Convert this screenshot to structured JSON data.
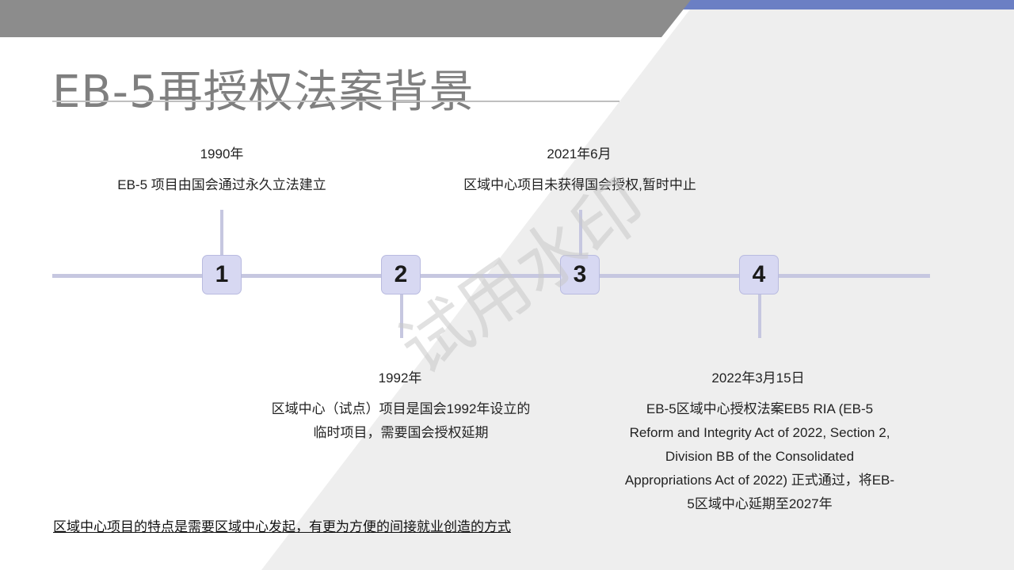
{
  "slide": {
    "title": "EB-5再授权法案背景",
    "colors": {
      "top_band_gray": "#8c8c8c",
      "top_band_blue": "#6b7fc4",
      "diagonal_gray": "#eeeeee",
      "timeline": "#c6c7e0",
      "marker_fill": "#d7d8f2"
    },
    "watermark": "试用水印"
  },
  "timeline": {
    "events": [
      {
        "number": "1",
        "date": "1990年",
        "lines": [
          "EB-5 项目由国会通过永久立法建立"
        ]
      },
      {
        "number": "2",
        "date": "1992年",
        "lines": [
          "区域中心（试点）项目是国会1992年设立的",
          "临时项目，需要国会授权延期"
        ]
      },
      {
        "number": "3",
        "date": "2021年6月",
        "lines": [
          "区域中心项目未获得国会授权,暂时中止"
        ]
      },
      {
        "number": "4",
        "date": "2022年3月15日",
        "lines": [
          "EB-5区域中心授权法案EB5 RIA (EB-5",
          "Reform and Integrity Act of 2022, Section 2,",
          "Division BB of the Consolidated",
          "Appropriations Act of 2022) 正式通过，将EB-",
          "5区域中心延期至2027年"
        ]
      }
    ]
  },
  "footer": {
    "note": "区域中心项目的特点是需要区域中心发起，有更为方便的间接就业创造的方式"
  }
}
